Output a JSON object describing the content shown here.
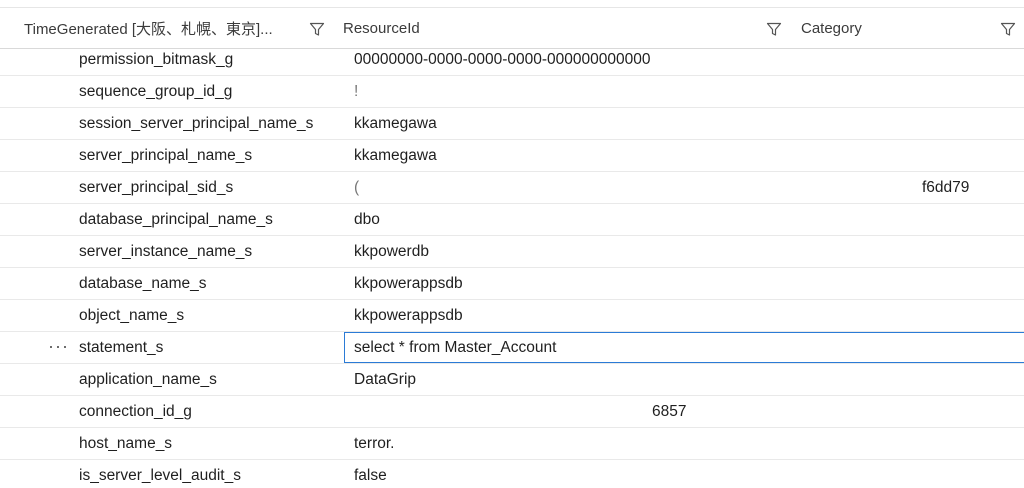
{
  "header": {
    "col_time": "TimeGenerated [大阪、札幌、東京]...",
    "col_resource": "ResourceId",
    "col_category": "Category"
  },
  "rows": [
    {
      "name": "permission_bitmask_g",
      "value": "00000000-0000-0000-0000-000000000000"
    },
    {
      "name": "sequence_group_id_g",
      "value": "!"
    },
    {
      "name": "session_server_principal_name_s",
      "value": "kkamegawa"
    },
    {
      "name": "server_principal_name_s",
      "value": "kkamegawa"
    },
    {
      "name": "server_principal_sid_s",
      "value": "(",
      "value_tail": "f6dd79"
    },
    {
      "name": "database_principal_name_s",
      "value": "dbo"
    },
    {
      "name": "server_instance_name_s",
      "value": "kkpowerdb"
    },
    {
      "name": "database_name_s",
      "value": "kkpowerappsdb"
    },
    {
      "name": "object_name_s",
      "value": "kkpowerappsdb"
    },
    {
      "name": "statement_s",
      "value": "select * from Master_Account",
      "selected": true,
      "more": "···"
    },
    {
      "name": "application_name_s",
      "value": "DataGrip"
    },
    {
      "name": "connection_id_g",
      "value_center": "6857"
    },
    {
      "name": "host_name_s",
      "value": "terror."
    },
    {
      "name": "is_server_level_audit_s",
      "value": "false"
    }
  ],
  "icons": {
    "filter": "filter-icon",
    "more": "more-actions-icon"
  },
  "colors": {
    "selection_border": "#2b7bd6",
    "row_divider": "#e9e9e9"
  }
}
